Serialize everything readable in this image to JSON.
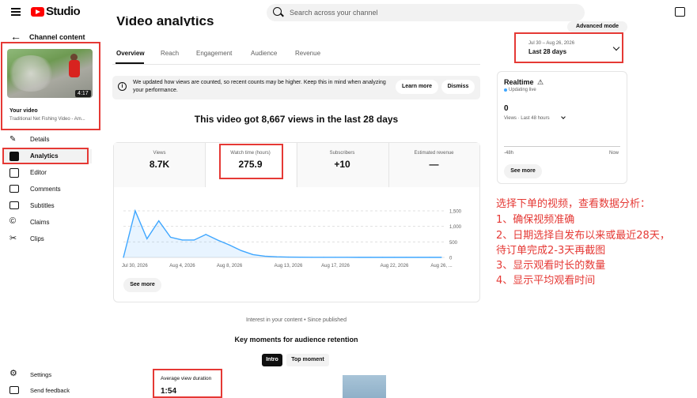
{
  "app": {
    "logo_text": "Studio",
    "search_placeholder": "Search across your channel"
  },
  "sidebar": {
    "title": "Channel content",
    "video": {
      "duration": "4:17",
      "label": "Your video",
      "title": "Traditional Net Fishing Video - Am..."
    },
    "items": [
      {
        "label": "Details",
        "icon": "pencil-icon"
      },
      {
        "label": "Analytics",
        "icon": "analytics-icon",
        "active": true
      },
      {
        "label": "Editor",
        "icon": "editor-icon"
      },
      {
        "label": "Comments",
        "icon": "comments-icon"
      },
      {
        "label": "Subtitles",
        "icon": "subtitles-icon"
      },
      {
        "label": "Claims",
        "icon": "copyright-icon"
      },
      {
        "label": "Clips",
        "icon": "scissors-icon"
      }
    ],
    "footer": [
      {
        "label": "Settings",
        "icon": "gear-icon"
      },
      {
        "label": "Send feedback",
        "icon": "feedback-icon"
      }
    ]
  },
  "header": {
    "title": "Video analytics",
    "advanced_mode": "Advanced mode",
    "tabs": [
      "Overview",
      "Reach",
      "Engagement",
      "Audience",
      "Revenue"
    ],
    "date_range": "Jul 30 – Aug 26, 2026",
    "date_label": "Last 28 days"
  },
  "notice": {
    "text": "We updated how views are counted, so recent counts may be higher. Keep this in mind when analyzing your performance.",
    "learn_more": "Learn more",
    "dismiss": "Dismiss"
  },
  "headline": "This video got 8,667 views in the last 28 days",
  "metrics": [
    {
      "label": "Views",
      "value": "8.7K"
    },
    {
      "label": "Watch time (hours)",
      "value": "275.9",
      "active": true
    },
    {
      "label": "Subscribers",
      "value": "+10"
    },
    {
      "label": "Estimated revenue",
      "value": "—"
    }
  ],
  "see_more": "See more",
  "chart_data": {
    "type": "area",
    "x": [
      "Jul 30",
      "Jul 31",
      "Aug 1",
      "Aug 2",
      "Aug 3",
      "Aug 4",
      "Aug 5",
      "Aug 6",
      "Aug 7",
      "Aug 8",
      "Aug 9",
      "Aug 10",
      "Aug 11",
      "Aug 12",
      "Aug 13",
      "Aug 14",
      "Aug 15",
      "Aug 16",
      "Aug 17",
      "Aug 18",
      "Aug 19",
      "Aug 20",
      "Aug 21",
      "Aug 22",
      "Aug 23",
      "Aug 24",
      "Aug 25",
      "Aug 26"
    ],
    "values": [
      0,
      1500,
      600,
      1180,
      650,
      560,
      560,
      740,
      560,
      400,
      220,
      90,
      40,
      20,
      12,
      8,
      5,
      5,
      4,
      4,
      3,
      3,
      3,
      3,
      3,
      3,
      3,
      3
    ],
    "xticks": [
      "Jul 30, 2026",
      "Aug 4, 2026",
      "Aug 8, 2026",
      "Aug 13, 2026",
      "Aug 17, 2026",
      "Aug 22, 2026",
      "Aug 26, ..."
    ],
    "xtick_index": [
      0,
      5,
      9,
      14,
      18,
      23,
      27
    ],
    "yticks": [
      "1,500",
      "1,000",
      "500",
      "0"
    ],
    "ytick_values": [
      1500,
      1000,
      500,
      0
    ],
    "ylim": [
      0,
      1500
    ],
    "color": "#3ea6ff"
  },
  "realtime": {
    "title": "Realtime",
    "status": "Updating live",
    "value": "0",
    "sub": "Views · Last 48 hours",
    "tick_left": "-48h",
    "tick_right": "Now",
    "see_more": "See more"
  },
  "annotation": [
    "选择下单的视频，查看数据分析：",
    "1、确保视频准确",
    "2、日期选择自发布以来或最近28天，",
    "待订单完成2-3天再截图",
    "3、显示观看时长的数量",
    "4、显示平均观看时间"
  ],
  "bottom": {
    "interest": "Interest in your content • Since published",
    "key_moments": "Key moments for audience retention",
    "toggle_intro": "Intro",
    "toggle_top": "Top moment",
    "avd_label": "Average view duration",
    "avd_value": "1:54"
  },
  "colors": {
    "accent": "#3ea6ff",
    "annotation": "#e53935",
    "brand": "#ff0000"
  }
}
